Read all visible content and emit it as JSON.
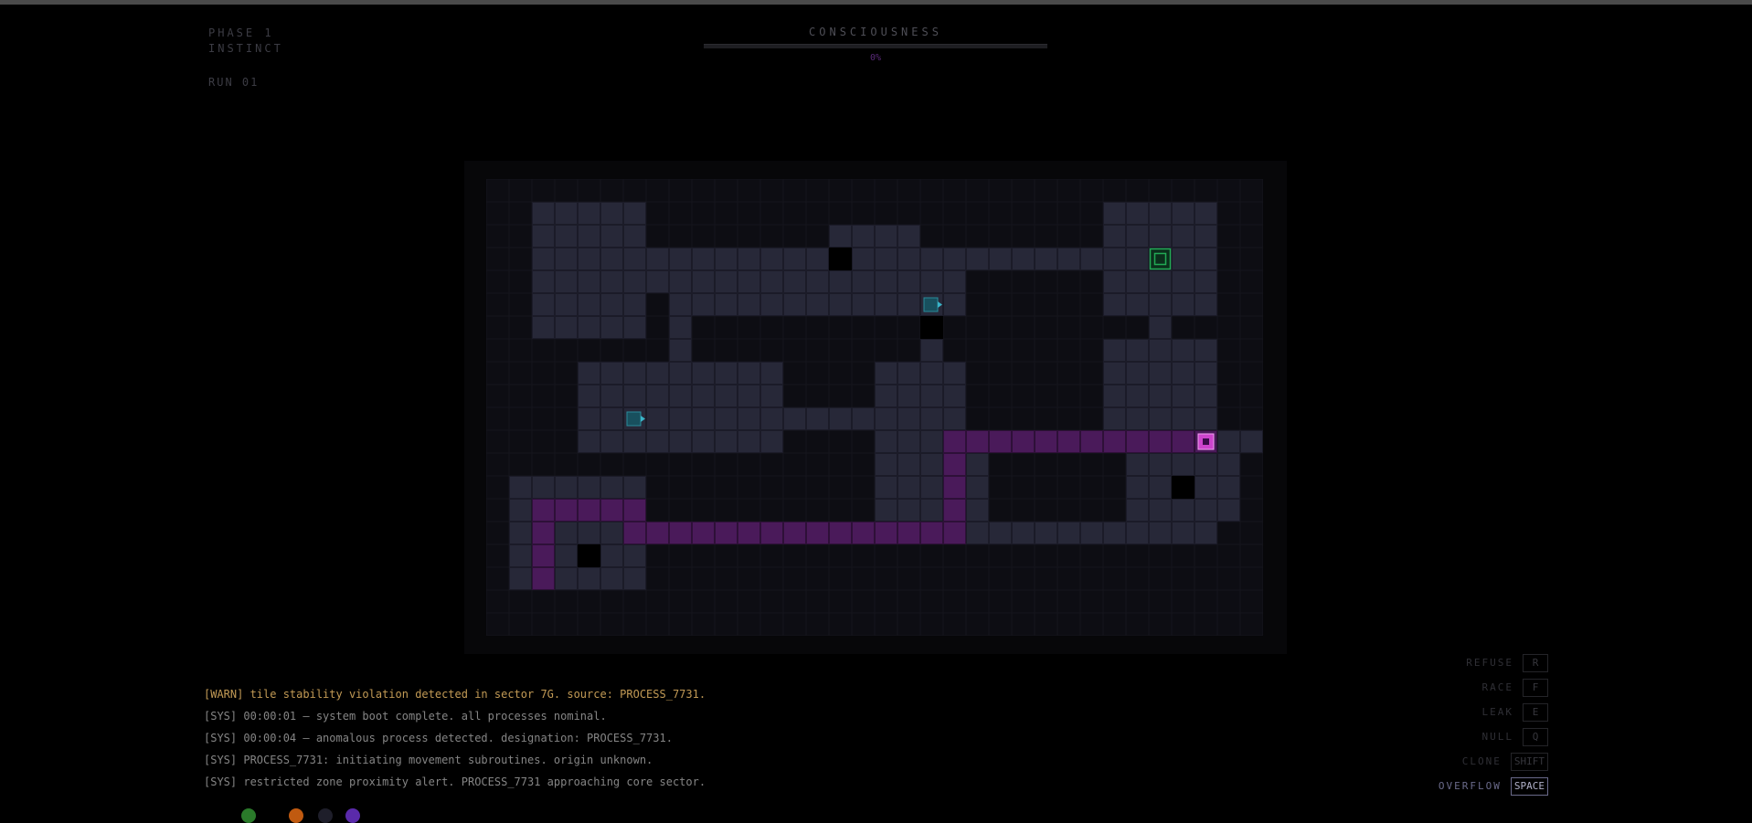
{
  "hud": {
    "phase": "PHASE 1",
    "stage": "INSTINCT",
    "run": "RUN 01",
    "consciousness_label": "CONSCIOUSNESS",
    "consciousness_value": "0%",
    "consciousness_fraction": 0.0
  },
  "colors": {
    "background": "#000000",
    "board": "#0d0d13",
    "floor_tile": "#272838",
    "path_tile": "#4a1a5a",
    "player": "#cc44cc",
    "goal": "#22aa55",
    "agent": "#2a8a9a",
    "warn_text": "#c29a55"
  },
  "map": {
    "rows": [
      ".................................",
      "..LLLLL....................LLLLL.",
      "..LLLLL........LLLL........LLLLL.",
      "..LLLLLLLLLLLLLXLLLLLLLLLLLLLGLL.",
      "..LLLLLLLLLLLLLLLLLLL......LLLLL.",
      "..LLLLL.LLLLLLLLLLLAL......LLLLL.",
      "..LLLLL.L..........X.........L...",
      "........L..........L.......LLLLL.",
      "....LLLLLLLLL....LLLL......LLLLL.",
      "....LLLLLLLLL....LLLL......LLLLL.",
      "....LLALLLLLLLLLLLLLL......LLLLL.",
      "....LLLLLLLLL....LLLPPPPPPPPPPPSLL",
      ".................LLLPL......LLLLL.",
      ".LLLLLL..........LLLPL......LLXLL.",
      ".LPPPPP..........LLLPL......LLLLL.",
      ".LPLLLPPPPPPPPPPPPPPPLLLLLLLLLLL..",
      ".LPLXLL..........................",
      ".LPLLLL..........................",
      ".................................."
    ],
    "legend": {
      "L": "floor",
      "P": "path",
      "X": "void",
      "S": "player",
      "G": "goal",
      "A": "agent",
      ".": "empty"
    }
  },
  "log": [
    "[WARN] tile stability violation detected in sector 7G. source: PROCESS_7731.",
    "[SYS] 00:00:01 — system boot complete. all processes nominal.",
    "[SYS] 00:00:04 — anomalous process detected. designation: PROCESS_7731.",
    "[SYS] PROCESS_7731: initiating movement subroutines. origin unknown.",
    "[SYS] restricted zone proximity alert. PROCESS_7731 approaching core sector."
  ],
  "controls": [
    {
      "label": "REFUSE",
      "key": "R"
    },
    {
      "label": "RACE",
      "key": "F"
    },
    {
      "label": "LEAK",
      "key": "E"
    },
    {
      "label": "NULL",
      "key": "Q"
    },
    {
      "label": "CLONE",
      "key": "SHIFT"
    },
    {
      "label": "OVERFLOW",
      "key": "SPACE"
    }
  ],
  "dots": [
    "#2a7a2a",
    "#c05a10",
    "#1e1e2a",
    "#5a2aaa"
  ]
}
